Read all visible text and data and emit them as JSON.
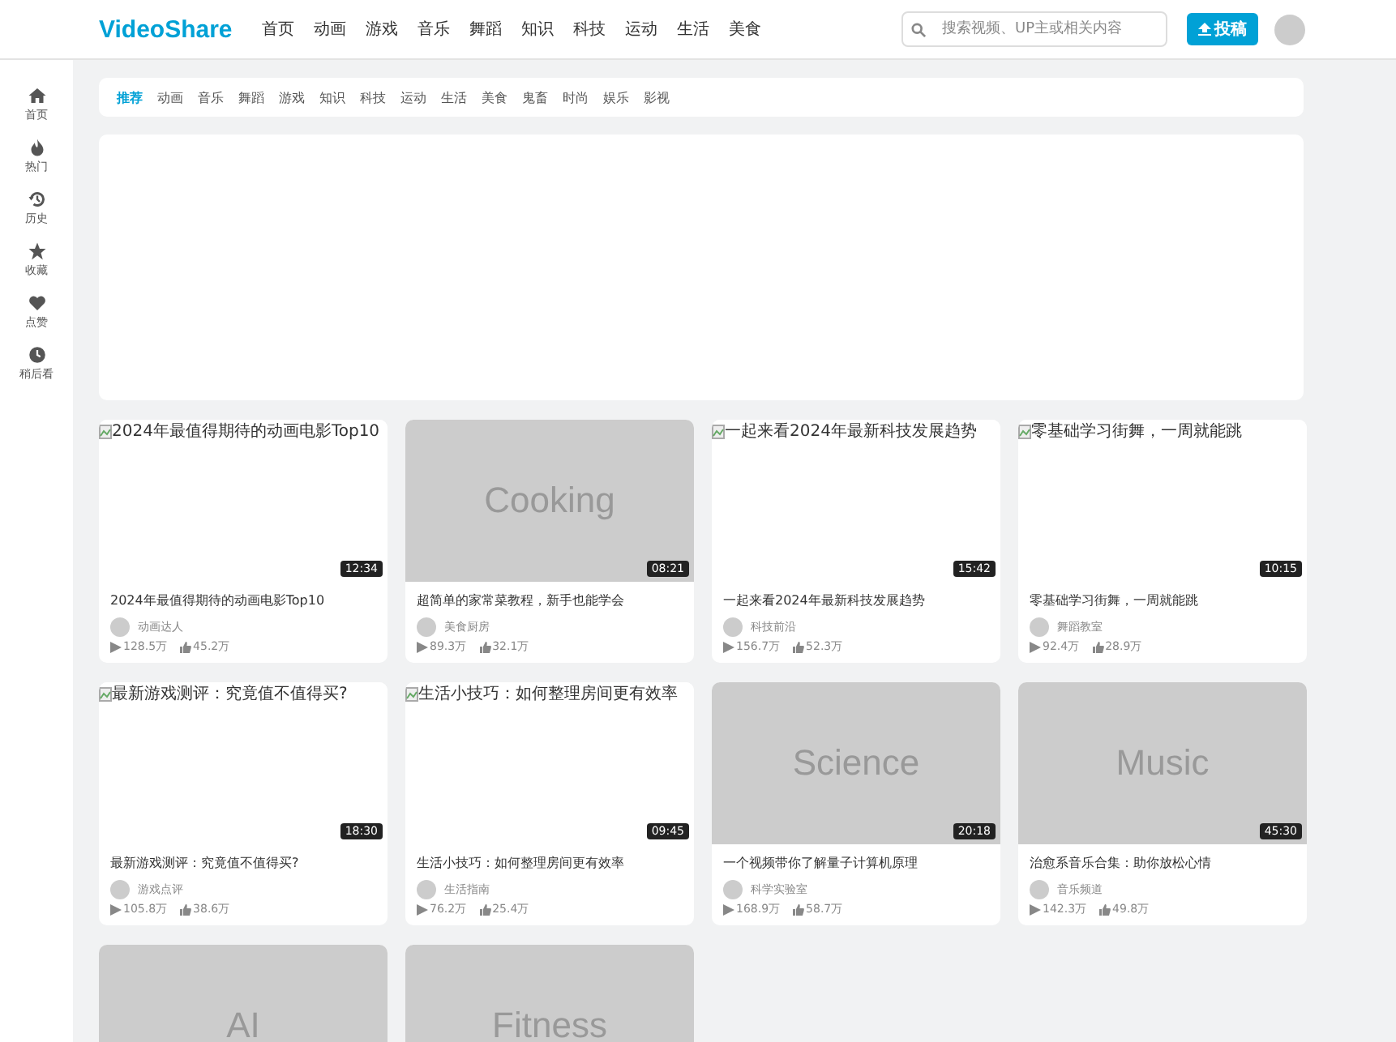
{
  "header": {
    "logo": "VideoShare",
    "nav": [
      "首页",
      "动画",
      "游戏",
      "音乐",
      "舞蹈",
      "知识",
      "科技",
      "运动",
      "生活",
      "美食"
    ],
    "search": {
      "placeholder": "搜索视频、UP主或相关内容"
    },
    "upload_button": "投稿"
  },
  "sidebar": {
    "items": [
      {
        "kind": "home",
        "label": "首页"
      },
      {
        "kind": "fire",
        "label": "热门"
      },
      {
        "kind": "history",
        "label": "历史"
      },
      {
        "kind": "star",
        "label": "收藏"
      },
      {
        "kind": "heart",
        "label": "点赞"
      },
      {
        "kind": "clock",
        "label": "稍后看"
      }
    ]
  },
  "categories": [
    {
      "label": "推荐",
      "selected": true
    },
    {
      "label": "动画",
      "selected": false
    },
    {
      "label": "音乐",
      "selected": false
    },
    {
      "label": "舞蹈",
      "selected": false
    },
    {
      "label": "游戏",
      "selected": false
    },
    {
      "label": "知识",
      "selected": false
    },
    {
      "label": "科技",
      "selected": false
    },
    {
      "label": "运动",
      "selected": false
    },
    {
      "label": "生活",
      "selected": false
    },
    {
      "label": "美食",
      "selected": false
    },
    {
      "label": "鬼畜",
      "selected": false
    },
    {
      "label": "时尚",
      "selected": false
    },
    {
      "label": "娱乐",
      "selected": false
    },
    {
      "label": "影视",
      "selected": false
    }
  ],
  "videos": [
    {
      "kind": "broken",
      "thumb_text": "2024年最值得期待的动画电影Top10",
      "duration": "12:34",
      "title": "2024年最值得期待的动画电影Top10",
      "author": "动画达人",
      "views": "128.5万",
      "likes": "45.2万"
    },
    {
      "kind": "placeholder",
      "thumb_text": "Cooking",
      "duration": "08:21",
      "title": "超简单的家常菜教程，新手也能学会",
      "author": "美食厨房",
      "views": "89.3万",
      "likes": "32.1万"
    },
    {
      "kind": "broken",
      "thumb_text": "一起来看2024年最新科技发展趋势",
      "duration": "15:42",
      "title": "一起来看2024年最新科技发展趋势",
      "author": "科技前沿",
      "views": "156.7万",
      "likes": "52.3万"
    },
    {
      "kind": "broken",
      "thumb_text": "零基础学习街舞，一周就能跳",
      "duration": "10:15",
      "title": "零基础学习街舞，一周就能跳",
      "author": "舞蹈教室",
      "views": "92.4万",
      "likes": "28.9万"
    },
    {
      "kind": "broken",
      "thumb_text": "最新游戏测评：究竟值不值得买?",
      "duration": "18:30",
      "title": "最新游戏测评：究竟值不值得买?",
      "author": "游戏点评",
      "views": "105.8万",
      "likes": "38.6万"
    },
    {
      "kind": "broken",
      "thumb_text": "生活小技巧：如何整理房间更有效率",
      "duration": "09:45",
      "title": "生活小技巧：如何整理房间更有效率",
      "author": "生活指南",
      "views": "76.2万",
      "likes": "25.4万"
    },
    {
      "kind": "placeholder",
      "thumb_text": "Science",
      "duration": "20:18",
      "title": "一个视频带你了解量子计算机原理",
      "author": "科学实验室",
      "views": "168.9万",
      "likes": "58.7万"
    },
    {
      "kind": "placeholder",
      "thumb_text": "Music",
      "duration": "45:30",
      "title": "治愈系音乐合集：助你放松心情",
      "author": "音乐频道",
      "views": "142.3万",
      "likes": "49.8万"
    },
    {
      "kind": "placeholder",
      "thumb_text": "AI"
    },
    {
      "kind": "placeholder",
      "thumb_text": "Fitness"
    }
  ]
}
